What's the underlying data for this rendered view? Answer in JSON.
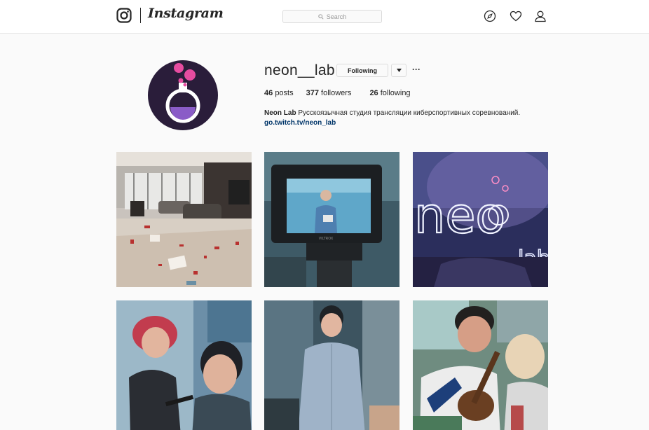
{
  "header": {
    "logo_text": "Instagram",
    "logo_icon": "camera-icon",
    "search_placeholder": "Search",
    "nav_icons": [
      "compass-icon",
      "heart-icon",
      "person-icon"
    ]
  },
  "profile": {
    "username": "neon__lab",
    "follow_label": "Following",
    "more_glyph": "···",
    "stats": [
      {
        "count": "46",
        "label": "posts"
      },
      {
        "count": "377",
        "label": "followers"
      },
      {
        "count": "26",
        "label": "following"
      }
    ],
    "bio_name": "Neon Lab",
    "bio_text": "Русскоязычная студия трансляции киберспортивных соревнований.",
    "bio_link": "go.twitch.tv/neon_lab"
  },
  "photos": [
    {
      "desc": "living-room-photo"
    },
    {
      "desc": "camera-monitor-photo",
      "monitor_text": "VILTROX"
    },
    {
      "desc": "neon-sign-photo",
      "sign_text": "neo",
      "sign_sub": "lab"
    },
    {
      "desc": "makeup-photo"
    },
    {
      "desc": "man-standing-photo"
    },
    {
      "desc": "ukulele-photo"
    }
  ],
  "colors": {
    "accent": "#003569",
    "border": "#dbdbdb",
    "text": "#262626"
  }
}
